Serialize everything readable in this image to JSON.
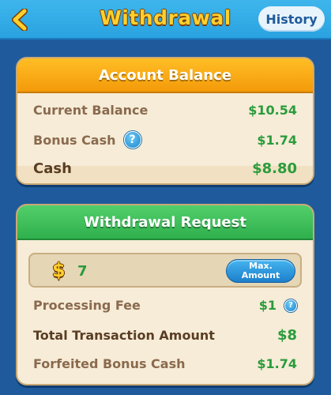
{
  "header": {
    "title": "Withdrawal",
    "history_label": "History",
    "back_icon": "chevron-left-icon"
  },
  "balance": {
    "title": "Account Balance",
    "current_label": "Current Balance",
    "current_value": "$10.54",
    "bonus_label": "Bonus Cash",
    "bonus_value": "$1.74",
    "cash_label": "Cash",
    "cash_value": "$8.80"
  },
  "request": {
    "title": "Withdrawal Request",
    "currency_symbol": "$",
    "amount_value": "7",
    "max_label_line1": "Max.",
    "max_label_line2": "Amount",
    "fee_label": "Processing Fee",
    "fee_value": "$1",
    "total_label": "Total Transaction Amount",
    "total_value": "$8",
    "forfeited_label": "Forfeited Bonus Cash",
    "forfeited_value": "$1.74"
  },
  "colors": {
    "background": "#1f5b9c",
    "header": "#2aa2e0",
    "title_gold": "#ffcf2e",
    "balance_header": "#f49a0a",
    "request_header": "#2fb04c",
    "money_green": "#2a9c3c",
    "card_bg": "#f6ecd7"
  }
}
